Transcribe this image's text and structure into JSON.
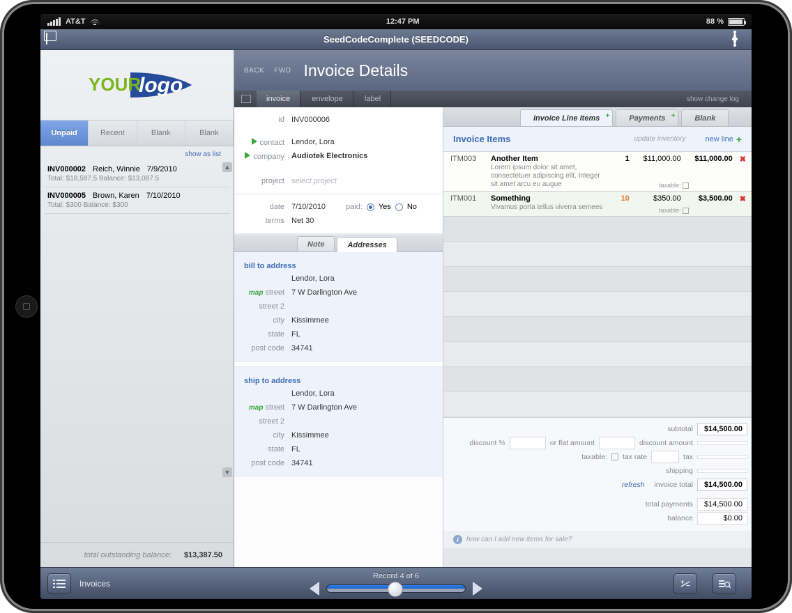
{
  "ios": {
    "carrier": "AT&T",
    "time": "12:47 PM",
    "battery": "88 %"
  },
  "app": {
    "title": "SeedCodeComplete (SEEDCODE)"
  },
  "logo": {
    "text1": "YOUR",
    "text2": "logo",
    "color1": "#7ab51d",
    "color2": "#254b9b"
  },
  "sidebar": {
    "tabs": [
      "Unpaid",
      "Recent",
      "Blank",
      "Blank"
    ],
    "show_as_list": "show as list",
    "invoices": [
      {
        "id": "INV000002",
        "name": "Reich, Winnie",
        "date": "7/9/2010",
        "summary": "Total: $18,587.5 Balance: $13,087.5"
      },
      {
        "id": "INV000005",
        "name": "Brown, Karen",
        "date": "7/10/2010",
        "summary": "Total: $300 Balance: $300"
      }
    ],
    "footer": {
      "label": "total outstanding balance:",
      "value": "$13,387.50"
    }
  },
  "header": {
    "back": "BACK",
    "fwd": "FWD",
    "title": "Invoice Details"
  },
  "subheader": {
    "invoice": "invoice",
    "envelope": "envelope",
    "label": "label",
    "changelog": "show change log"
  },
  "form": {
    "id_label": "id",
    "id": "INV000006",
    "contact_label": "contact",
    "contact": "Lendor, Lora",
    "company_label": "company",
    "company": "Audiotek Electronics",
    "project_label": "project",
    "project_hint": "select project",
    "date_label": "date",
    "date": "7/10/2010",
    "paid_label": "paid:",
    "paid_yes": "Yes",
    "paid_no": "No",
    "terms_label": "terms",
    "terms": "Net 30",
    "tabs": {
      "note": "Note",
      "addresses": "Addresses"
    },
    "bill": {
      "head": "bill to address",
      "map": "map",
      "street_l": "street",
      "street": "7 W Darlington Ave",
      "street2_l": "street 2",
      "street2": "",
      "city_l": "city",
      "city": "Kissimmee",
      "state_l": "state",
      "state": "FL",
      "post_l": "post code",
      "post": "34741",
      "name": "Lendor, Lora"
    },
    "ship": {
      "head": "ship to address",
      "map": "map",
      "street_l": "street",
      "street": "7 W Darlington Ave",
      "street2_l": "street 2",
      "street2": "",
      "city_l": "city",
      "city": "Kissimmee",
      "state_l": "state",
      "state": "FL",
      "post_l": "post code",
      "post": "34741",
      "name": "Lendor, Lora"
    }
  },
  "items": {
    "tabs": [
      "Invoice Line Items",
      "Payments",
      "Blank"
    ],
    "heading": "Invoice Items",
    "update": "update inventory",
    "newline": "new line",
    "taxable_label": "taxable:",
    "rows": [
      {
        "sku": "ITM003",
        "name": "Another Item",
        "desc": "Lorem ipsum dolor sit amet, consectetuer adipiscing elit. Integer sit amet arcu eu augue",
        "qty": "1",
        "price": "$11,000.00",
        "ext": "$11,000.00"
      },
      {
        "sku": "ITM001",
        "name": "Something",
        "desc": "Vivamus porta tellus viverra semees",
        "qty": "10",
        "price": "$350.00",
        "ext": "$3,500.00"
      }
    ],
    "totals": {
      "subtotal_l": "subtotal",
      "subtotal": "$14,500.00",
      "disc_pct": "discount %",
      "flat": "or flat amount",
      "disc_amt": "discount amount",
      "taxable": "taxable:",
      "taxrate": "tax rate",
      "tax": "tax",
      "shipping": "shipping",
      "refresh": "refresh",
      "inv_total_l": "invoice total",
      "inv_total": "$14,500.00",
      "totpay_l": "total payments",
      "totpay": "$14,500.00",
      "balance_l": "balance",
      "balance": "$0.00"
    },
    "hint": "how can I add new items for sale?"
  },
  "footer": {
    "section": "Invoices",
    "record": "Record 4 of 6"
  }
}
